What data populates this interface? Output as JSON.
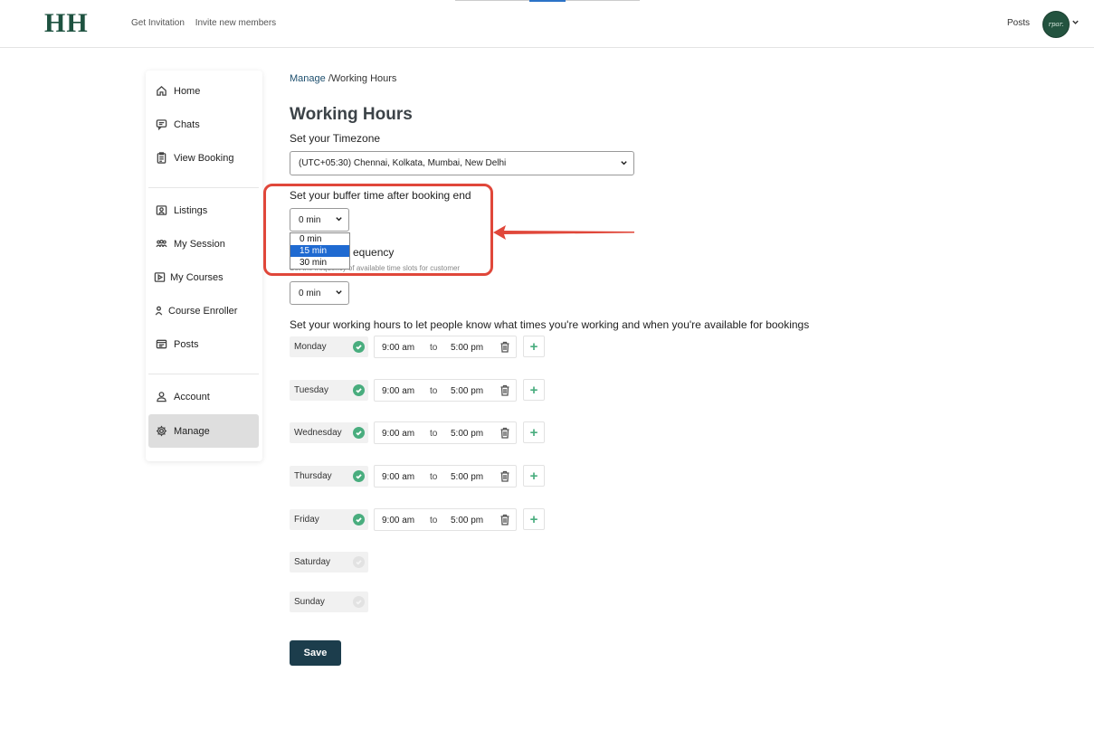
{
  "header": {
    "logo": "HH",
    "nav": [
      "Get Invitation",
      "Invite new members"
    ],
    "posts_link": "Posts",
    "avatar_text": "rpar."
  },
  "sidebar": {
    "items": [
      {
        "label": "Home",
        "icon": "home-icon"
      },
      {
        "label": "Chats",
        "icon": "chat-icon"
      },
      {
        "label": "View Booking",
        "icon": "clipboard-icon"
      },
      {
        "label": "Listings",
        "icon": "listing-icon"
      },
      {
        "label": "My Session",
        "icon": "group-icon"
      },
      {
        "label": "My Courses",
        "icon": "play-icon"
      },
      {
        "label": "Course Enroller",
        "icon": "person-icon"
      },
      {
        "label": "Posts",
        "icon": "posts-icon"
      },
      {
        "label": "Account",
        "icon": "account-icon"
      },
      {
        "label": "Manage",
        "icon": "gear-icon"
      }
    ],
    "active": "Manage"
  },
  "breadcrumb": {
    "link": "Manage",
    "current": " /Working Hours"
  },
  "page": {
    "title": "Working Hours",
    "timezone_label": "Set your Timezone",
    "timezone_value": "(UTC+05:30) Chennai, Kolkata, Mumbai, New Delhi",
    "buffer_label": "Set your buffer time after booking end",
    "buffer_value": "0 min",
    "buffer_options": [
      "0 min",
      "15 min",
      "30 min"
    ],
    "buffer_highlighted_option": "15 min",
    "frequency_label": "equency",
    "frequency_helper": "Set the frequency of available time slots for customer",
    "frequency_value": "0 min",
    "hours_label": "Set your working hours to let people know what times you're working and when you're available for bookings",
    "to_label": "to",
    "save_label": "Save"
  },
  "days": [
    {
      "name": "Monday",
      "enabled": true,
      "start": "9:00 am",
      "end": "5:00 pm"
    },
    {
      "name": "Tuesday",
      "enabled": true,
      "start": "9:00 am",
      "end": "5:00 pm"
    },
    {
      "name": "Wednesday",
      "enabled": true,
      "start": "9:00 am",
      "end": "5:00 pm"
    },
    {
      "name": "Thursday",
      "enabled": true,
      "start": "9:00 am",
      "end": "5:00 pm"
    },
    {
      "name": "Friday",
      "enabled": true,
      "start": "9:00 am",
      "end": "5:00 pm"
    },
    {
      "name": "Saturday",
      "enabled": false
    },
    {
      "name": "Sunday",
      "enabled": false
    }
  ],
  "colors": {
    "brand": "#1e5240",
    "accent_green": "#49ad7e",
    "highlight_red": "#e0473a",
    "save_button": "#1c3d4c",
    "selected_option": "#1f6ad1"
  }
}
